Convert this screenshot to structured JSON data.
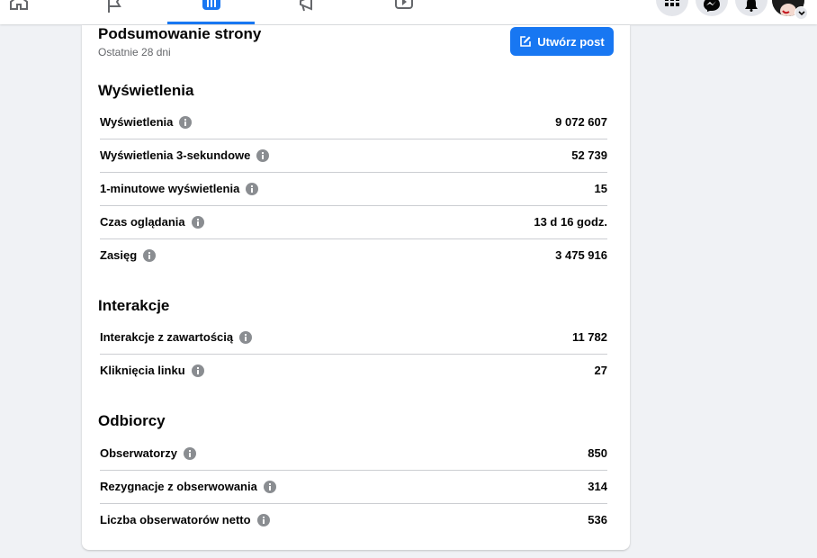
{
  "header": {
    "create_post_label": "Utwórz post"
  },
  "summary": {
    "title": "Podsumowanie strony",
    "subtitle": "Ostatnie 28 dni"
  },
  "sections": {
    "views": {
      "title": "Wyświetlenia",
      "rows": [
        {
          "label": "Wyświetlenia",
          "value": "9 072 607"
        },
        {
          "label": "Wyświetlenia 3-sekundowe",
          "value": "52 739"
        },
        {
          "label": "1-minutowe wyświetlenia",
          "value": "15"
        },
        {
          "label": "Czas oglądania",
          "value": "13 d 16 godz."
        },
        {
          "label": "Zasięg",
          "value": "3 475 916"
        }
      ]
    },
    "interactions": {
      "title": "Interakcje",
      "rows": [
        {
          "label": "Interakcje z zawartością",
          "value": "11 782"
        },
        {
          "label": "Kliknięcia linku",
          "value": "27"
        }
      ]
    },
    "audience": {
      "title": "Odbiorcy",
      "rows": [
        {
          "label": "Obserwatorzy",
          "value": "850"
        },
        {
          "label": "Rezygnacje z obserwowania",
          "value": "314"
        },
        {
          "label": "Liczba obserwatorów netto",
          "value": "536"
        }
      ]
    }
  },
  "colors": {
    "accent": "#1877f2",
    "secondary_text": "#65676b",
    "info_icon": "#8a8d91",
    "divider": "#ccced2"
  }
}
